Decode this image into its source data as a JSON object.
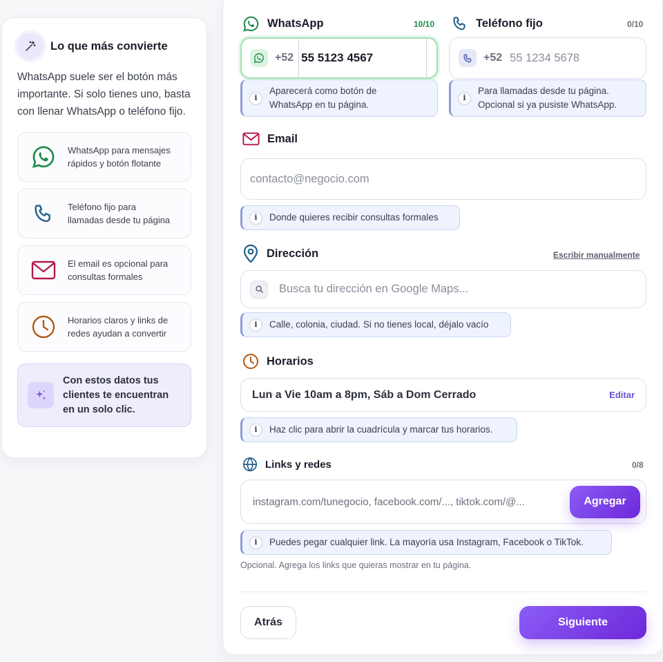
{
  "sidebar": {
    "title": "Lo que más convierte",
    "intro": "WhatsApp suele ser el botón más importante. Si solo tienes uno, basta con llenar WhatsApp o teléfono fijo.",
    "tips": [
      {
        "icon": "whatsapp-icon",
        "text_1": "WhatsApp para mensajes",
        "text_2": "rápidos y botón flotante"
      },
      {
        "icon": "phone-icon",
        "text_1": "Teléfono fijo para",
        "text_2": "llamadas desde tu página"
      },
      {
        "icon": "mail-icon",
        "text_1": "El email es opcional para",
        "text_2": "consultas formales"
      },
      {
        "icon": "clock-icon",
        "text_1": "Horarios claros y links de",
        "text_2": "redes ayudan a convertir"
      }
    ],
    "promo_1": "Con estos datos tus",
    "promo_2": "clientes te encuentran",
    "promo_3": "en un solo clic."
  },
  "whatsapp": {
    "label": "WhatsApp",
    "count": "10/10",
    "prefix": "+52",
    "value": "55 5123 4567",
    "hint_1": "Aparecerá como botón de",
    "hint_2": "WhatsApp en tu página."
  },
  "phone": {
    "label": "Teléfono fijo",
    "count": "0/10",
    "prefix": "+52",
    "placeholder": "55 1234 5678",
    "hint_1": "Para llamadas desde tu página.",
    "hint_2": "Opcional si ya pusiste WhatsApp."
  },
  "email": {
    "label": "Email",
    "placeholder": "contacto@negocio.com",
    "hint": "Donde quieres recibir consultas formales"
  },
  "address": {
    "label": "Dirección",
    "manual_link": "Escribir manualmente",
    "placeholder": "Busca tu dirección en Google Maps...",
    "hint": "Calle, colonia, ciudad. Si no tienes local, déjalo vacío"
  },
  "hours": {
    "label": "Horarios",
    "value": "Lun a Vie 10am a 8pm, Sáb a Dom Cerrado",
    "edit_label": "Editar",
    "hint": "Haz clic para abrir la cuadrícula y marcar tus horarios."
  },
  "links": {
    "label": "Links y redes",
    "count": "0/8",
    "placeholder": "instagram.com/tunegocio, facebook.com/..., tiktok.com/@...",
    "add_label": "Agregar",
    "hint": "Puedes pegar cualquier link. La mayoría usa Instagram, Facebook o TikTok.",
    "optional": "Opcional. Agrega los links que quieras mostrar en tu página."
  },
  "footer": {
    "back_label": "Atrás",
    "next_label": "Siguiente"
  },
  "colors": {
    "whatsapp": "#1f8a4c",
    "phone": "#1f5f8a",
    "mail": "#b3194a",
    "clock": "#b05a16",
    "accent": "#7c3aed"
  }
}
